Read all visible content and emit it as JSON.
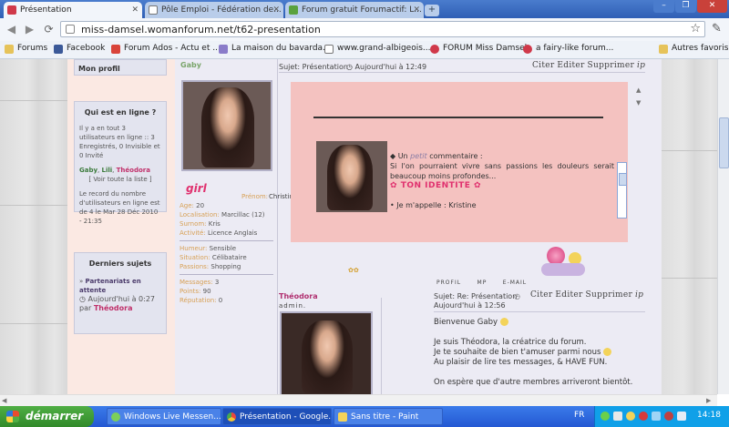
{
  "tabs": [
    {
      "label": "Présentation",
      "active": true
    },
    {
      "label": "Pôle Emploi - Fédération de...",
      "active": false
    },
    {
      "label": "Forum gratuit Forumactif: L...",
      "active": false
    }
  ],
  "new_tab": "+",
  "window_controls": {
    "minimize": "–",
    "maximize": "❐",
    "close": "✕"
  },
  "url": "miss-damsel.womanforum.net/t62-presentation",
  "bookmarks": [
    "Forums",
    "Facebook",
    "Forum Ados - Actu et ...",
    "La maison du bavarda...",
    "www.grand-albigeois....",
    "FORUM Miss Damsel",
    "a fairy-like forum...",
    "Autres favoris"
  ],
  "sidebar": {
    "profile_link": "Mon profil",
    "who_online": {
      "title": "Qui est en ligne ?",
      "text": "Il y a en tout 3 utilisateurs en ligne :: 3 Enregistrés, 0 Invisible et 0 Invité",
      "users": [
        "Gaby",
        "Lili",
        "Théodora"
      ],
      "list_link": "[ Voir toute la liste ]",
      "record": "Le record du nombre d'utilisateurs en ligne est de 4 le Mar 28 Déc 2010 - 21:35"
    },
    "recent": {
      "title": "Derniers sujets",
      "topic": "Partenariats en attente",
      "time": "Aujourd'hui à 0:27",
      "by": "par",
      "author": "Théodora"
    }
  },
  "post1": {
    "author": "Gaby",
    "author_tag": "girl",
    "subject": "Sujet: Présentation",
    "date": "Aujourd'hui à 12:49",
    "actions": [
      "Citer",
      "Editer",
      "Supprimer",
      "ip"
    ],
    "profile": [
      {
        "k": "Prénom:",
        "v": "Christine"
      },
      {
        "k": "Age:",
        "v": "20"
      },
      {
        "k": "Localisation:",
        "v": "Marcillac (12)"
      },
      {
        "k": "Surnom:",
        "v": "Kris"
      },
      {
        "k": "Activité:",
        "v": "Licence Anglais"
      },
      {
        "k": "Humeur:",
        "v": "Sensible"
      },
      {
        "k": "Situation:",
        "v": "Célibataire"
      },
      {
        "k": "Passions:",
        "v": "Shopping"
      },
      {
        "k": "Messages:",
        "v": "3"
      },
      {
        "k": "Points:",
        "v": "90"
      },
      {
        "k": "Réputation:",
        "v": "0"
      }
    ],
    "body_prefix": "◆ Un ",
    "body_em": "petit",
    "body_suffix": " commentaire :",
    "quote": "Si l'on pourraient vivre sans passions les douleurs serait beaucoup moins profondes...",
    "heading": "TON IDENTITE",
    "line": "• Je m'appelle : Kristine",
    "footer_links": [
      "PROFIL",
      "MP",
      "E-MAIL"
    ]
  },
  "post2": {
    "author": "Théodora",
    "role": "admin.",
    "subject": "Sujet: Re: Présentation",
    "date": "Aujourd'hui à 12:56",
    "actions": [
      "Citer",
      "Editer",
      "Supprimer",
      "ip"
    ],
    "lines": [
      "Bienvenue Gaby",
      "Je suis Théodora, la créatrice du forum.",
      "Je te souhaite de bien t'amuser parmi nous",
      "Au plaisir de lire tes messages, & HAVE FUN.",
      "On espère que d'autre membres arriveront bientôt."
    ]
  },
  "taskbar": {
    "start": "démarrer",
    "tasks": [
      "Windows Live Messen...",
      "Présentation - Google...",
      "Sans titre - Paint"
    ],
    "lang": "FR",
    "time": "14:18"
  }
}
